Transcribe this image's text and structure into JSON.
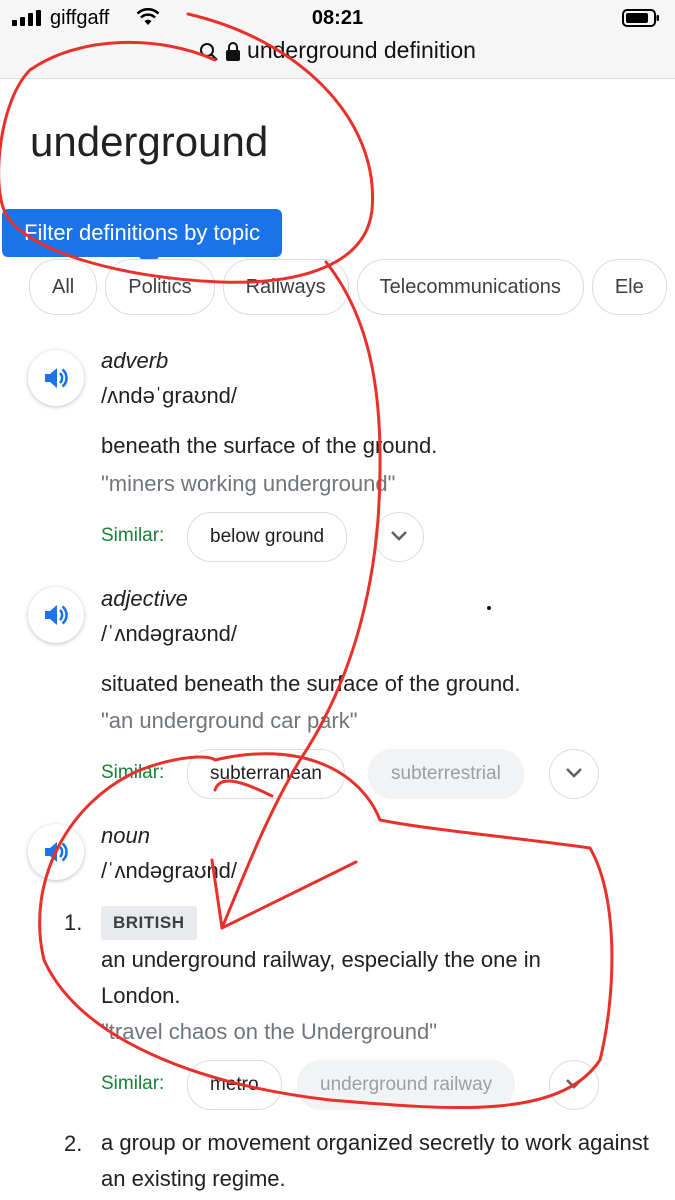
{
  "status_bar": {
    "carrier": "giffgaff",
    "time": "08:21"
  },
  "url_bar": {
    "text": "underground definition"
  },
  "word": "underground",
  "filter_tooltip": "Filter definitions by topic",
  "topic_chips": [
    "All",
    "Politics",
    "Railways",
    "Telecommunications",
    "Ele"
  ],
  "similar_label": "Similar:",
  "entries": [
    {
      "pos": "adverb",
      "pronunciation": "/ʌndəˈɡraʊnd/",
      "definition": "beneath the surface of the ground.",
      "example": "\"miners working underground\"",
      "synonyms": [
        "below ground"
      ]
    },
    {
      "pos": "adjective",
      "pronunciation": "/ˈʌndəɡraʊnd/",
      "definition": "situated beneath the surface of the ground.",
      "example": "\"an underground car park\"",
      "synonyms": [
        "subterranean",
        "subterrestrial"
      ]
    },
    {
      "pos": "noun",
      "pronunciation": "/ˈʌndəɡraʊnd/",
      "senses": [
        {
          "number": "1.",
          "label": "BRITISH",
          "definition": "an underground railway, especially the one in London.",
          "example": "\"travel chaos on the Underground\"",
          "synonyms": [
            "metro",
            "underground railway"
          ]
        },
        {
          "number": "2.",
          "definition": "a group or movement organized secretly to work against an existing regime."
        }
      ]
    }
  ],
  "colors": {
    "accent": "#1a73e8",
    "similar": "#188038",
    "annotation": "#e8312a"
  },
  "icons": [
    "signal-icon",
    "wifi-icon",
    "battery-icon",
    "search-icon",
    "lock-icon",
    "speaker-icon",
    "chevron-down-icon"
  ]
}
